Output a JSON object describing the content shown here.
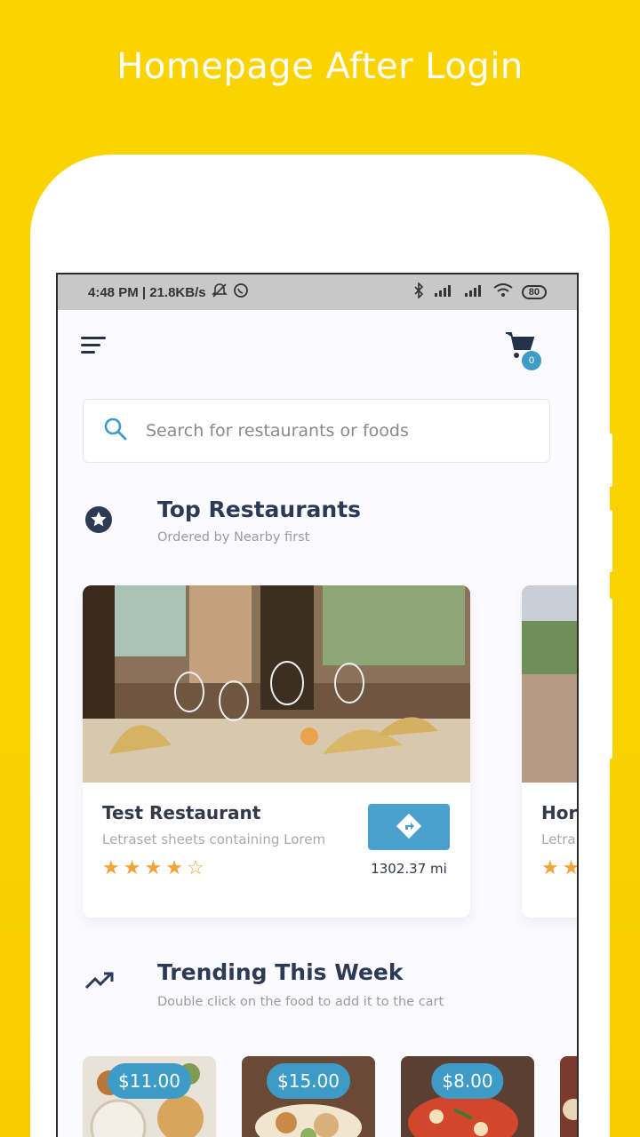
{
  "promo": {
    "title": "Homepage After Login"
  },
  "status_bar": {
    "time_speed": "4:48 PM | 21.8KB/s",
    "battery": "80"
  },
  "header": {
    "cart_count": "0"
  },
  "search": {
    "placeholder": "Search for restaurants or foods"
  },
  "top_restaurants": {
    "title": "Top Restaurants",
    "subtitle": "Ordered by Nearby first",
    "cards": [
      {
        "name": "Test Restaurant",
        "description": "Letraset sheets containing Lorem",
        "rating": 4,
        "rating_max": 5,
        "distance": "1302.37 mi"
      },
      {
        "name": "Hor",
        "description": "Letra",
        "rating": 2,
        "rating_max": 5,
        "distance": ""
      }
    ]
  },
  "trending": {
    "title": "Trending This Week",
    "subtitle": "Double click on the food to add it to the cart",
    "items": [
      {
        "price": "$11.00"
      },
      {
        "price": "$15.00"
      },
      {
        "price": "$8.00"
      },
      {
        "price": ""
      }
    ]
  },
  "colors": {
    "background": "#fbd400",
    "accent": "#3f9cc9",
    "title": "#2c3a55",
    "star": "#f2a33a"
  }
}
